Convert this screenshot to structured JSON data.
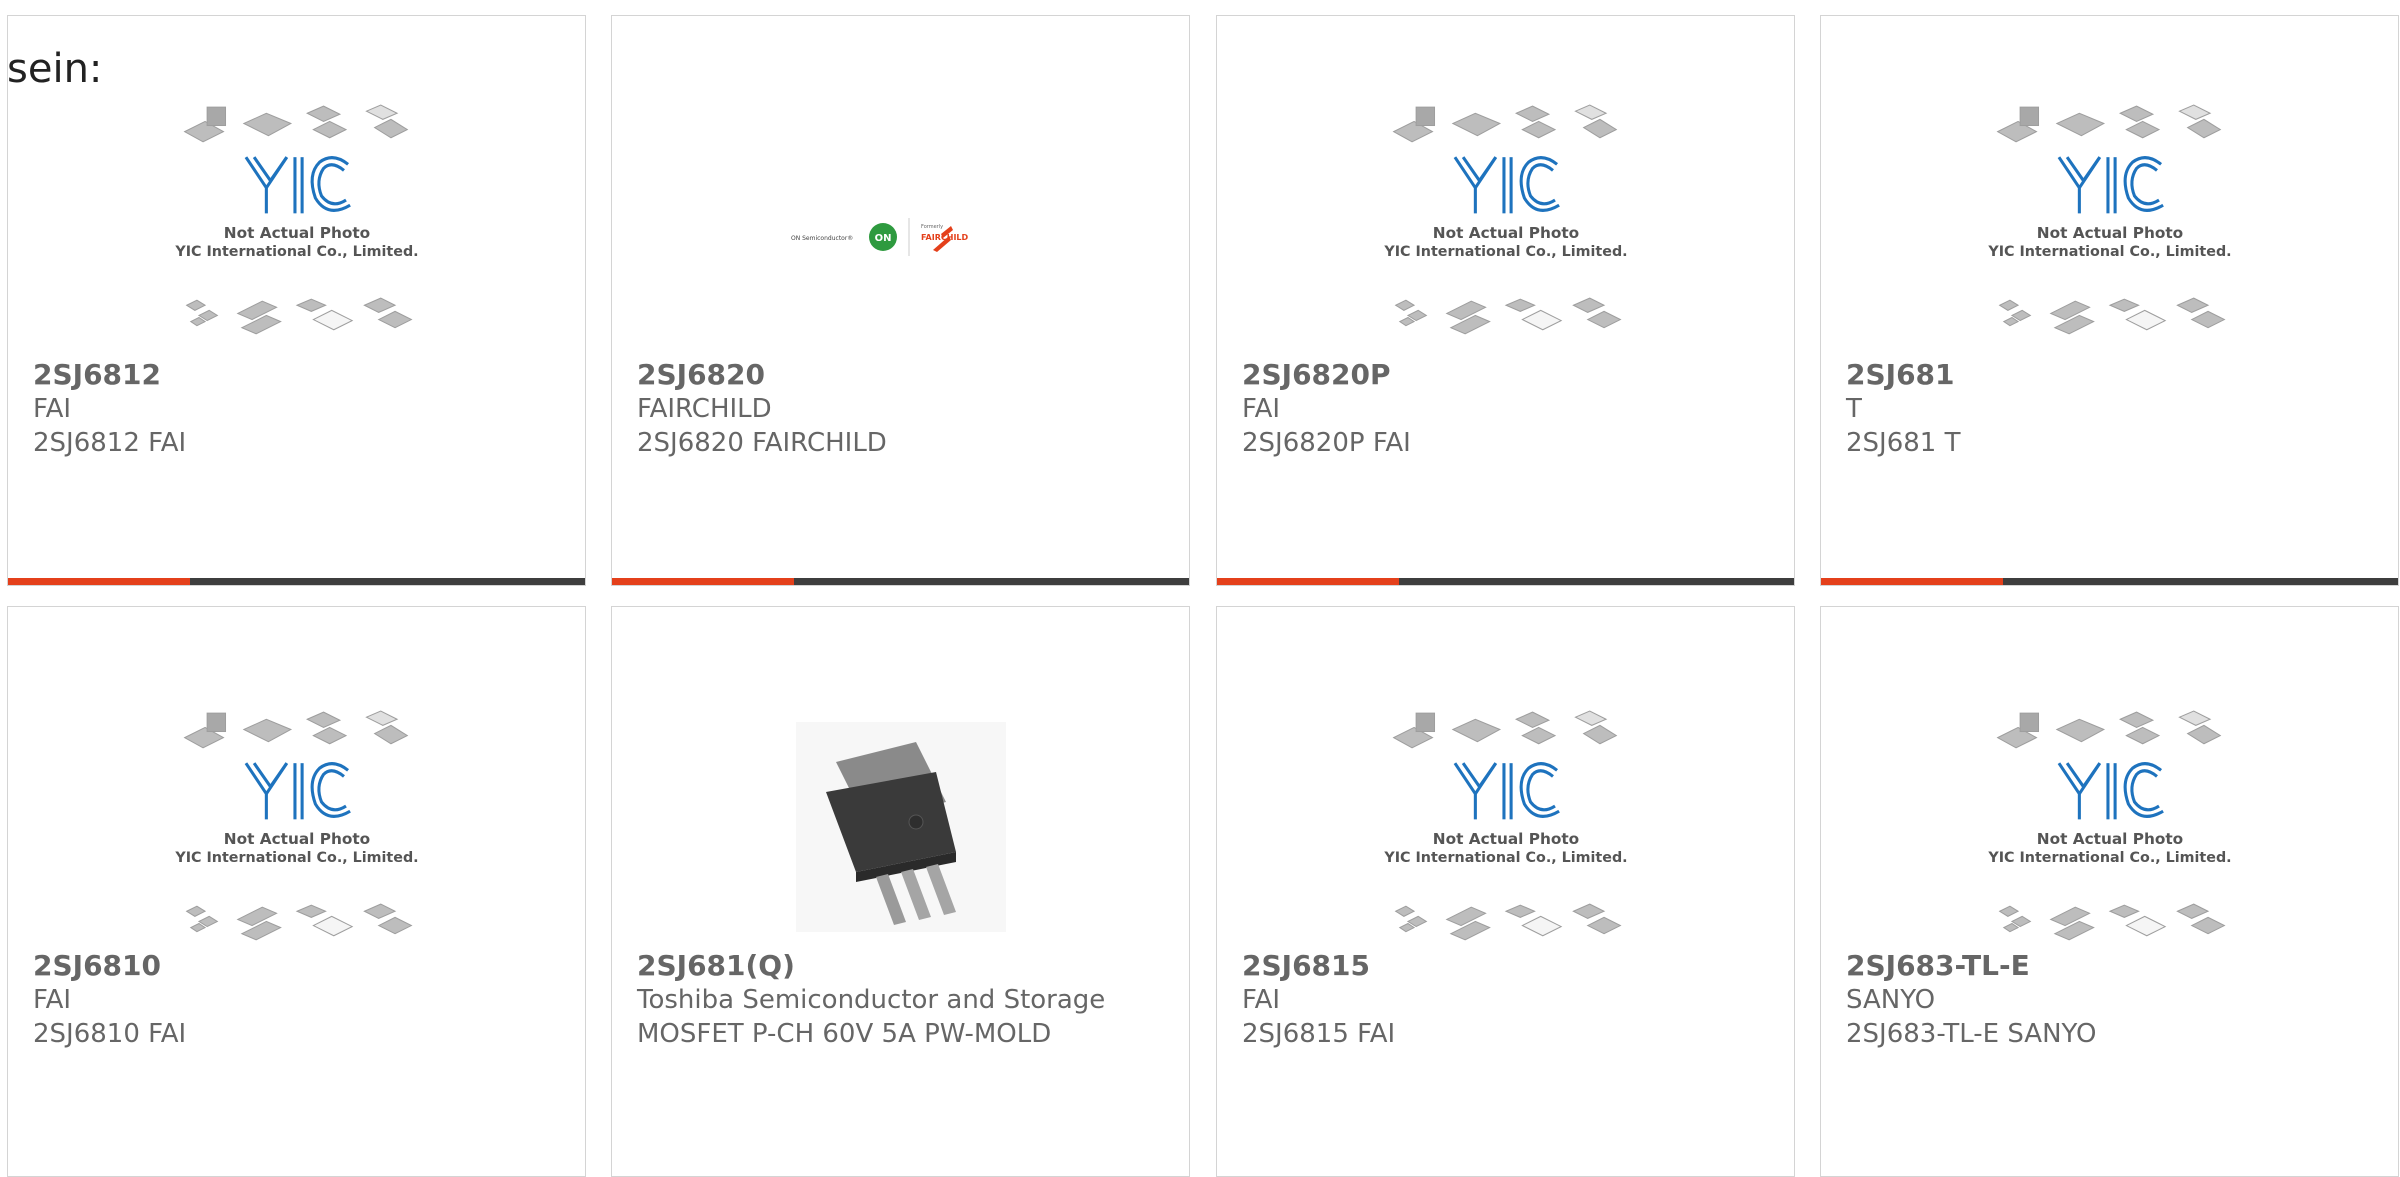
{
  "page": {
    "cut_label": "sein:"
  },
  "placeholder_image": {
    "line1": "Not Actual Photo",
    "line2": "YIC International Co., Limited.",
    "logo_text": "YIC"
  },
  "brand_logo": {
    "left_text": "ON Semiconductor®",
    "badge_text": "ON",
    "formerly_text": "Formerly",
    "right_text": "FAIRCHILD"
  },
  "products": [
    {
      "part_number": "2SJ6812",
      "manufacturer": "FAI",
      "description": "2SJ6812 FAI",
      "image": "placeholder"
    },
    {
      "part_number": "2SJ6820",
      "manufacturer": "FAIRCHILD",
      "description": "2SJ6820 FAIRCHILD",
      "image": "brand-logo"
    },
    {
      "part_number": "2SJ6820P",
      "manufacturer": "FAI",
      "description": "2SJ6820P FAI",
      "image": "placeholder"
    },
    {
      "part_number": "2SJ681",
      "manufacturer": "T",
      "description": "2SJ681 T",
      "image": "placeholder"
    },
    {
      "part_number": "2SJ6810",
      "manufacturer": "FAI",
      "description": "2SJ6810 FAI",
      "image": "placeholder"
    },
    {
      "part_number": "2SJ681(Q)",
      "manufacturer": "Toshiba Semiconductor and Storage",
      "description": "MOSFET P-CH 60V 5A PW-MOLD",
      "image": "part-photo"
    },
    {
      "part_number": "2SJ6815",
      "manufacturer": "FAI",
      "description": "2SJ6815 FAI",
      "image": "placeholder"
    },
    {
      "part_number": "2SJ683-TL-E",
      "manufacturer": "SANYO",
      "description": "2SJ683-TL-E SANYO",
      "image": "placeholder"
    }
  ],
  "colors": {
    "accent": "#e4401b",
    "bar": "#3e3e3e",
    "text": "#666666",
    "logo_blue": "#1e73be"
  }
}
